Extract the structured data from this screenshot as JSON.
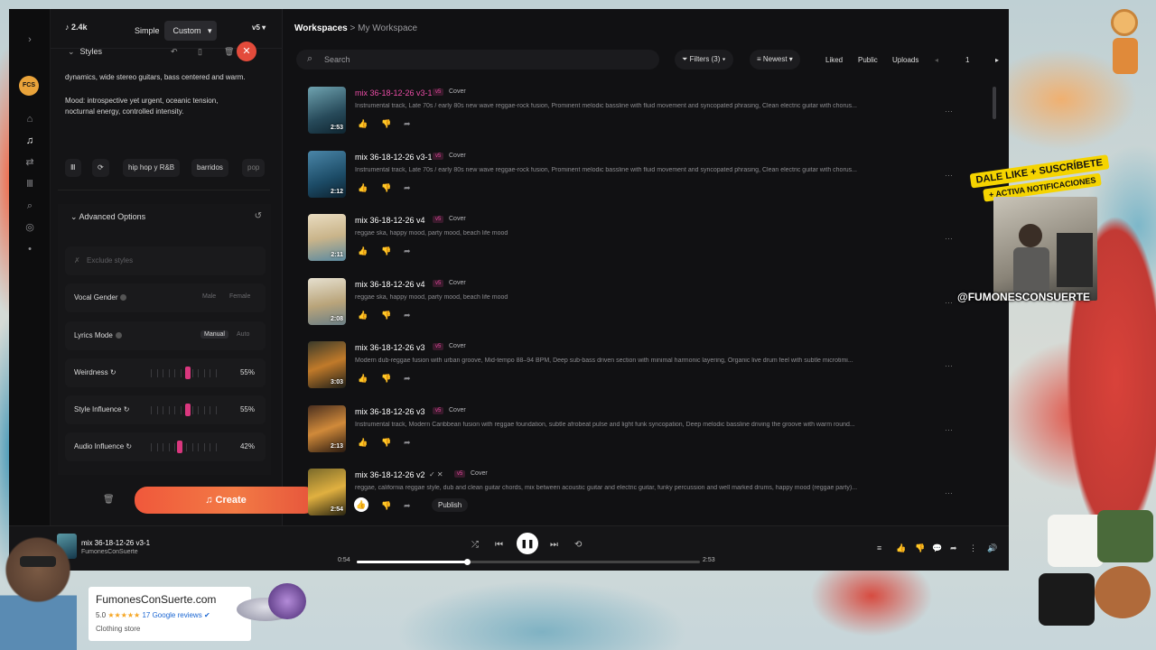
{
  "app": {
    "credits": "2.4k",
    "mode_simple": "Simple",
    "mode_custom": "Custom",
    "version": "v5",
    "logo_text": "FCS"
  },
  "styles_panel": {
    "title": "Styles",
    "text_1": "dynamics, wide stereo guitars, bass centered and warm.",
    "text_2": "Mood: introspective yet urgent, oceanic tension, nocturnal energy, controlled intensity.",
    "tags": [
      "hip hop y R&B",
      "barridos",
      "pop"
    ]
  },
  "advanced": {
    "title": "Advanced Options",
    "exclude_placeholder": "Exclude styles",
    "vocal_gender": {
      "label": "Vocal Gender",
      "opt1": "Male",
      "opt2": "Female"
    },
    "lyrics_mode": {
      "label": "Lyrics Mode",
      "opt1": "Manual",
      "opt2": "Auto"
    },
    "weirdness": {
      "label": "Weirdness",
      "value": "55%",
      "level": 0.55
    },
    "style_influence": {
      "label": "Style Influence",
      "value": "55%",
      "level": 0.55
    },
    "audio_influence": {
      "label": "Audio Influence",
      "value": "42%",
      "level": 0.42
    }
  },
  "create_label": "Create",
  "header": {
    "crumb_1": "Workspaces",
    "crumb_sep": ">",
    "crumb_2": "My Workspace",
    "search_placeholder": "Search",
    "filters": "Filters (3)",
    "sort": "Newest",
    "liked": "Liked",
    "public": "Public",
    "uploads": "Uploads",
    "page": "1"
  },
  "songs": [
    {
      "title": "mix 36-18-12-26 v3-1",
      "badge": "v5",
      "tag": "Cover",
      "desc": "Instrumental track, Late 70s / early 80s new wave reggae-rock fusion, Prominent melodic bassline with fluid movement and syncopated phrasing, Clean electric guitar with chorus...",
      "duration": "2:53",
      "active": true
    },
    {
      "title": "mix 36-18-12-26 v3-1",
      "badge": "v5",
      "tag": "Cover",
      "desc": "Instrumental track, Late 70s / early 80s new wave reggae-rock fusion, Prominent melodic bassline with fluid movement and syncopated phrasing, Clean electric guitar with chorus...",
      "duration": "2:12",
      "active": false
    },
    {
      "title": "mix 36-18-12-26 v4",
      "badge": "v5",
      "tag": "Cover",
      "desc": "reggae ska, happy mood, party mood, beach life mood",
      "duration": "2:11",
      "active": false
    },
    {
      "title": "mix 36-18-12-26 v4",
      "badge": "v5",
      "tag": "Cover",
      "desc": "reggae ska, happy mood, party mood, beach life mood",
      "duration": "2:08",
      "active": false
    },
    {
      "title": "mix 36-18-12-26 v3",
      "badge": "v5",
      "tag": "Cover",
      "desc": "Modern dub-reggae fusion with urban groove, Mid-tempo 88–94 BPM, Deep sub-bass driven section with minimal harmonic layering, Organic live drum feel with subtle microtimi...",
      "duration": "3:03",
      "active": false
    },
    {
      "title": "mix 36-18-12-26 v3",
      "badge": "v5",
      "tag": "Cover",
      "desc": "Instrumental track, Modern Caribbean fusion with reggae foundation, subtle afrobeat pulse and light funk syncopation, Deep melodic bassline driving the groove with warm round...",
      "duration": "2:13",
      "active": false
    },
    {
      "title": "mix 36-18-12-26 v2",
      "badge": "v5",
      "tag": "Cover",
      "desc": "reggae, california reggae style, dub and clean guitar chords, mix between acoustic guitar and electric guitar, funky percussion and well marked drums, happy mood (reggae party)...",
      "duration": "2:54",
      "active": false,
      "publish": "Publish"
    }
  ],
  "player": {
    "title": "mix 36-18-12-26 v3-1",
    "artist": "FumonesConSuerte",
    "elapsed": "0:54",
    "total": "2:53",
    "progress": 0.32
  },
  "overlay": {
    "promo_line1": "DALE LIKE + SUSCRÍBETE",
    "promo_line2": "+ ACTIVA NOTIFICACIONES",
    "handle": "@FUMONESCONSUERTE",
    "store_name": "FumonesConSuerte.com",
    "rating": "5.0",
    "stars": "★★★★★",
    "reviews": "17 Google reviews",
    "store_type": "Clothing store"
  },
  "colors": {
    "accent_pink": "#ea4da6",
    "create_orange": "#f0583b",
    "promo_yellow": "#f5d400"
  }
}
